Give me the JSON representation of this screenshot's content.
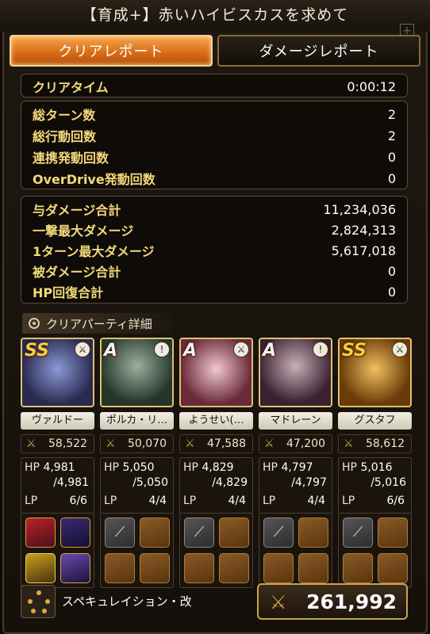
{
  "title": "【育成+】赤いハイビスカスを求めて",
  "tabs": {
    "clear_report": "クリアレポート",
    "damage_report": "ダメージレポート"
  },
  "clear_time": {
    "label": "クリアタイム",
    "value": "0:00:12"
  },
  "counts": [
    {
      "label": "総ターン数",
      "value": "2"
    },
    {
      "label": "総行動回数",
      "value": "2"
    },
    {
      "label": "連携発動回数",
      "value": "0"
    },
    {
      "label": "OverDrive発動回数",
      "value": "0"
    }
  ],
  "damage": [
    {
      "label": "与ダメージ合計",
      "value": "11,234,036"
    },
    {
      "label": "一撃最大ダメージ",
      "value": "2,824,313"
    },
    {
      "label": "1ターン最大ダメージ",
      "value": "5,617,018"
    },
    {
      "label": "被ダメージ合計",
      "value": "0"
    },
    {
      "label": "HP回復合計",
      "value": "0"
    }
  ],
  "party_label": "クリアパーティ詳細",
  "units": [
    {
      "rank": "SS",
      "name": "ヴァルドー",
      "power": "58,522",
      "hp": "4,981",
      "hp_max": "/4,981",
      "lp": "6/6",
      "color": "#5a6aa8"
    },
    {
      "rank": "A",
      "name": "ポルカ・リ…",
      "power": "50,070",
      "hp": "5,050",
      "hp_max": "/5,050",
      "lp": "4/4",
      "color": "#4a6a5a"
    },
    {
      "rank": "A",
      "name": "ようせい(…",
      "power": "47,588",
      "hp": "4,829",
      "hp_max": "/4,829",
      "lp": "4/4",
      "color": "#b05a6a"
    },
    {
      "rank": "A",
      "name": "マドレーン",
      "power": "47,200",
      "hp": "4,797",
      "hp_max": "/4,797",
      "lp": "4/4",
      "color": "#6a4a6a"
    },
    {
      "rank": "SS",
      "name": "グスタフ",
      "power": "58,612",
      "hp": "5,016",
      "hp_max": "/5,016",
      "lp": "6/6",
      "color": "#c88a2a"
    }
  ],
  "stat_labels": {
    "hp": "HP",
    "lp": "LP"
  },
  "formation": "スペキュレイション・改",
  "total_power": "261,992",
  "icons": {
    "sword": "⚔",
    "plus": "+"
  }
}
